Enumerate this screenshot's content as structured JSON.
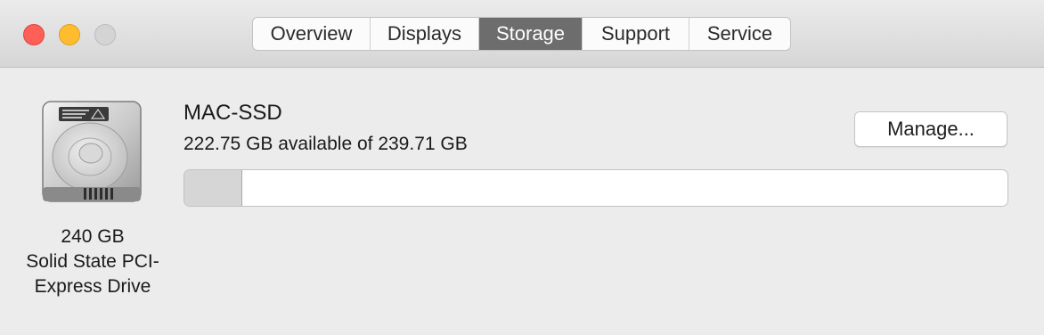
{
  "window": {
    "controls": [
      "close",
      "minimize",
      "zoom"
    ],
    "colors": {
      "close": "#fe5f57",
      "minimize": "#febc2e",
      "zoom_disabled": "#d4d4d4"
    }
  },
  "tabs": [
    {
      "label": "Overview",
      "active": false
    },
    {
      "label": "Displays",
      "active": false
    },
    {
      "label": "Storage",
      "active": true
    },
    {
      "label": "Support",
      "active": false
    },
    {
      "label": "Service",
      "active": false
    }
  ],
  "drive": {
    "icon": "hard-drive-icon",
    "capacity": "240 GB",
    "type_line1": "Solid State PCI-",
    "type_line2": "Express Drive"
  },
  "volume": {
    "name": "MAC-SSD",
    "available_text": "222.75 GB available of 239.71 GB",
    "used_fraction": 0.0707
  },
  "buttons": {
    "manage": "Manage..."
  },
  "colors": {
    "active_tab": "#6d6d6d",
    "used_segment": "#d6d6d6"
  }
}
